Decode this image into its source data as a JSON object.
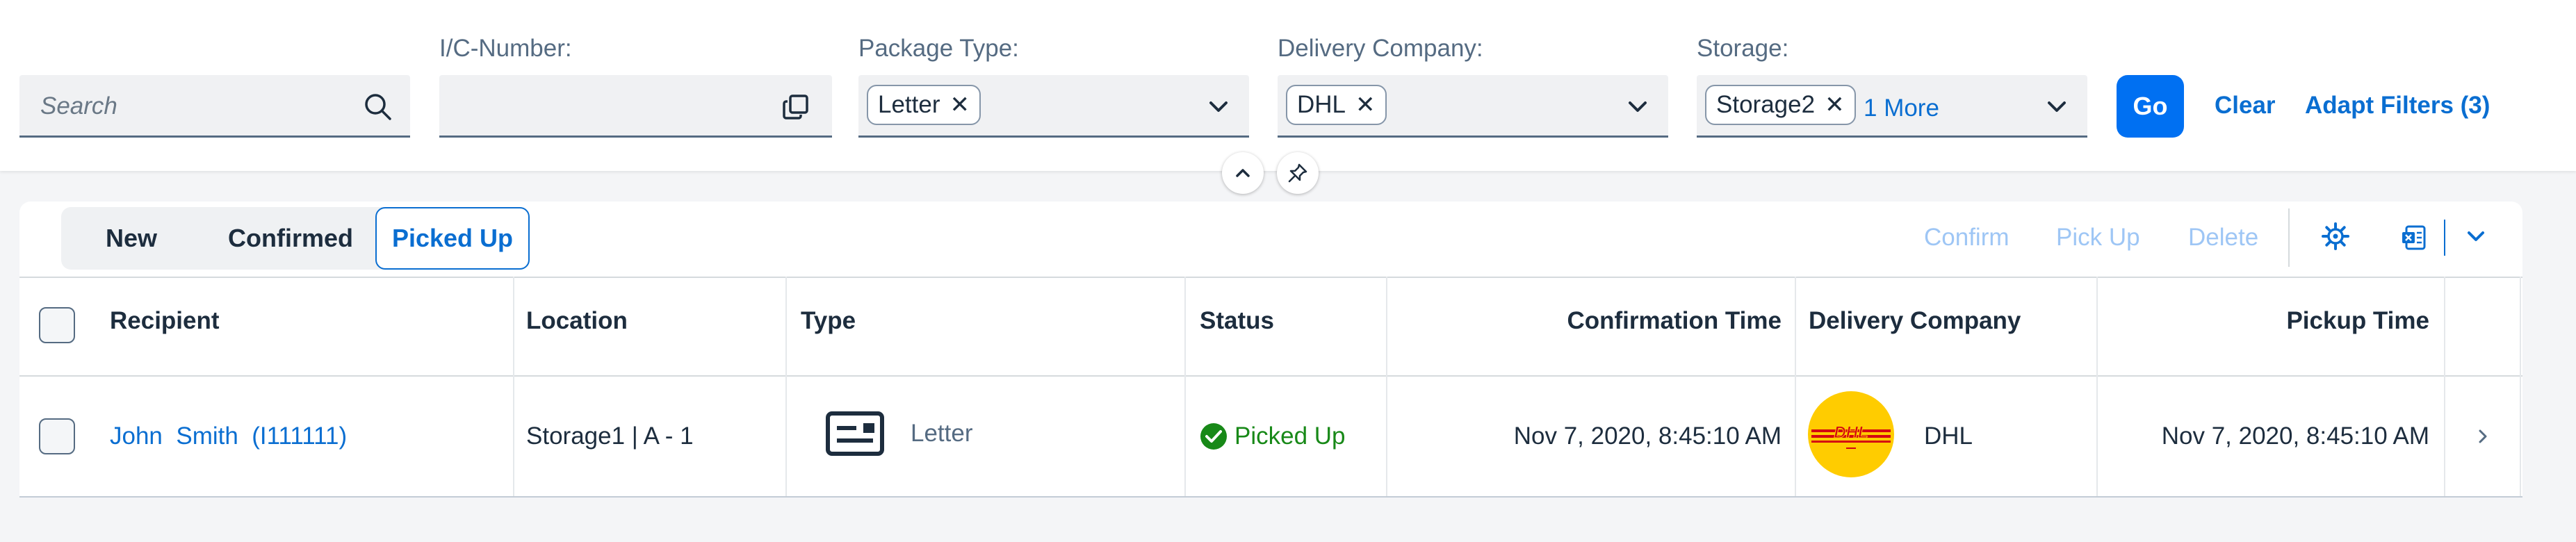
{
  "filters": {
    "search": {
      "placeholder": "Search"
    },
    "ic_number": {
      "label": "I/C-Number:",
      "value": ""
    },
    "package_type": {
      "label": "Package Type:",
      "tokens": [
        "Letter"
      ]
    },
    "delivery_company": {
      "label": "Delivery Company:",
      "tokens": [
        "DHL"
      ]
    },
    "storage": {
      "label": "Storage:",
      "tokens": [
        "Storage2"
      ],
      "more": "1 More"
    },
    "go_label": "Go",
    "clear_label": "Clear",
    "adapt_label": "Adapt Filters (3)"
  },
  "table": {
    "segments": [
      "New",
      "Confirmed",
      "Picked Up"
    ],
    "selected_segment": "Picked Up",
    "actions": {
      "confirm": "Confirm",
      "pickup": "Pick Up",
      "delete": "Delete"
    },
    "columns": [
      "Recipient",
      "Location",
      "Type",
      "Status",
      "Confirmation Time",
      "Delivery Company",
      "Pickup Time"
    ],
    "rows": [
      {
        "recipient": "John  Smith  (I111111)",
        "location": "Storage1 | A - 1",
        "type": "Letter",
        "status": "Picked Up",
        "confirmation_time": "Nov 7, 2020, 8:45:10 AM",
        "delivery_company": "DHL",
        "pickup_time": "Nov 7, 2020, 8:45:10 AM"
      }
    ]
  },
  "colors": {
    "accent": "#0a6ed1",
    "go_button": "#0070f2",
    "status_success": "#188918",
    "dhl_yellow": "#ffcc00",
    "dhl_red": "#d40511"
  }
}
